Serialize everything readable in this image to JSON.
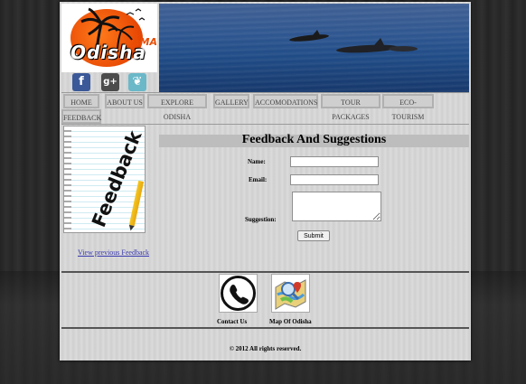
{
  "header": {
    "logo_text": "Odisha",
    "logo_sub": "AMA",
    "social": [
      {
        "icon": "facebook-icon",
        "glyph": "f"
      },
      {
        "icon": "google-plus-icon",
        "glyph": "g+"
      },
      {
        "icon": "bird-icon",
        "glyph": "❦"
      }
    ]
  },
  "nav": {
    "items": [
      "HOME",
      "ABOUT US",
      "EXPLORE ODISHA",
      "GALLERY",
      "ACCOMODATIONS",
      "TOUR PACKAGES",
      "ECO-TOURISM",
      "FEEDBACK"
    ]
  },
  "sidebar": {
    "image_text": "Feedback",
    "view_previous_link": "View previous Feedback"
  },
  "form": {
    "title": "Feedback And Suggestions",
    "name_label": "Name:",
    "email_label": "Email:",
    "suggestion_label": "Suggestion:",
    "name_value": "",
    "email_value": "",
    "submit_label": "Submit"
  },
  "footer": {
    "contact_label": "Contact Us",
    "map_label": "Map Of Odisha",
    "copyright": "© 2012 All rights reserved."
  },
  "colors": {
    "page_bg": "#d6d6d6",
    "link": "#3a3ab0",
    "banner_sea": "#1e4a85",
    "logo_sun": "#e94a05"
  }
}
